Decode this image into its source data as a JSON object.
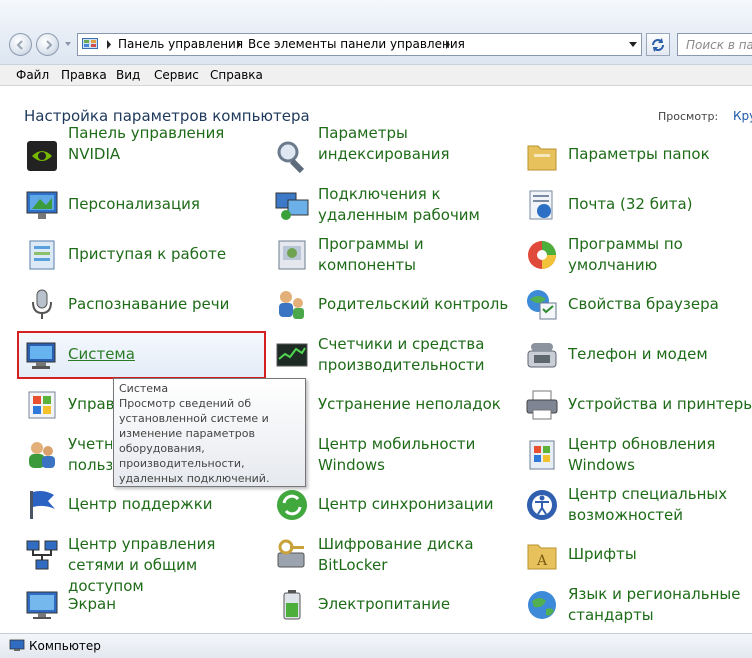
{
  "address": {
    "breadcrumbs": [
      "Панель управления",
      "Все элементы панели управления"
    ],
    "search_placeholder": "Поиск в пан"
  },
  "menu": [
    "Файл",
    "Правка",
    "Вид",
    "Сервис",
    "Справка"
  ],
  "header": {
    "title": "Настройка параметров компьютера",
    "view_label": "Просмотр:",
    "view_value": "Кру"
  },
  "items": {
    "nvidia": "Панель управления NVIDIA",
    "indexing": "Параметры индексирования",
    "folder_options": "Параметры папок",
    "personalization": "Персонализация",
    "remote_app": "Подключения к удаленным рабочим",
    "mail": "Почта (32 бита)",
    "getting_started": "Приступая к работе",
    "programs": "Программы и компоненты",
    "default_programs": "Программы по умолчанию",
    "speech": "Распознавание речи",
    "parental": "Родительский контроль",
    "internet_options": "Свойства браузера",
    "system": "Система",
    "perf": "Счетчики и средства производительности",
    "phone_modem": "Телефон и модем",
    "manage_cut": "Управ",
    "troubleshooting": "Устранение неполадок",
    "devices_printers": "Устройства и принтеры",
    "accounts_cut": "Учетн пользо",
    "mobility": "Центр мобильности Windows",
    "windows_update": "Центр обновления Windows",
    "action_center": "Центр поддержки",
    "sync_center": "Центр синхронизации",
    "ease_access": "Центр специальных возможностей",
    "network_center": "Центр управления сетями и общим доступом",
    "bitlocker": "Шифрование диска BitLocker",
    "fonts": "Шрифты",
    "display": "Экран",
    "power": "Электропитание",
    "region": "Язык и региональные стандарты"
  },
  "tooltip": {
    "title": "Система",
    "text": "Просмотр сведений об установленной системе и изменение параметров оборудования, производительности, удаленных подключений."
  },
  "status": "Компьютер"
}
